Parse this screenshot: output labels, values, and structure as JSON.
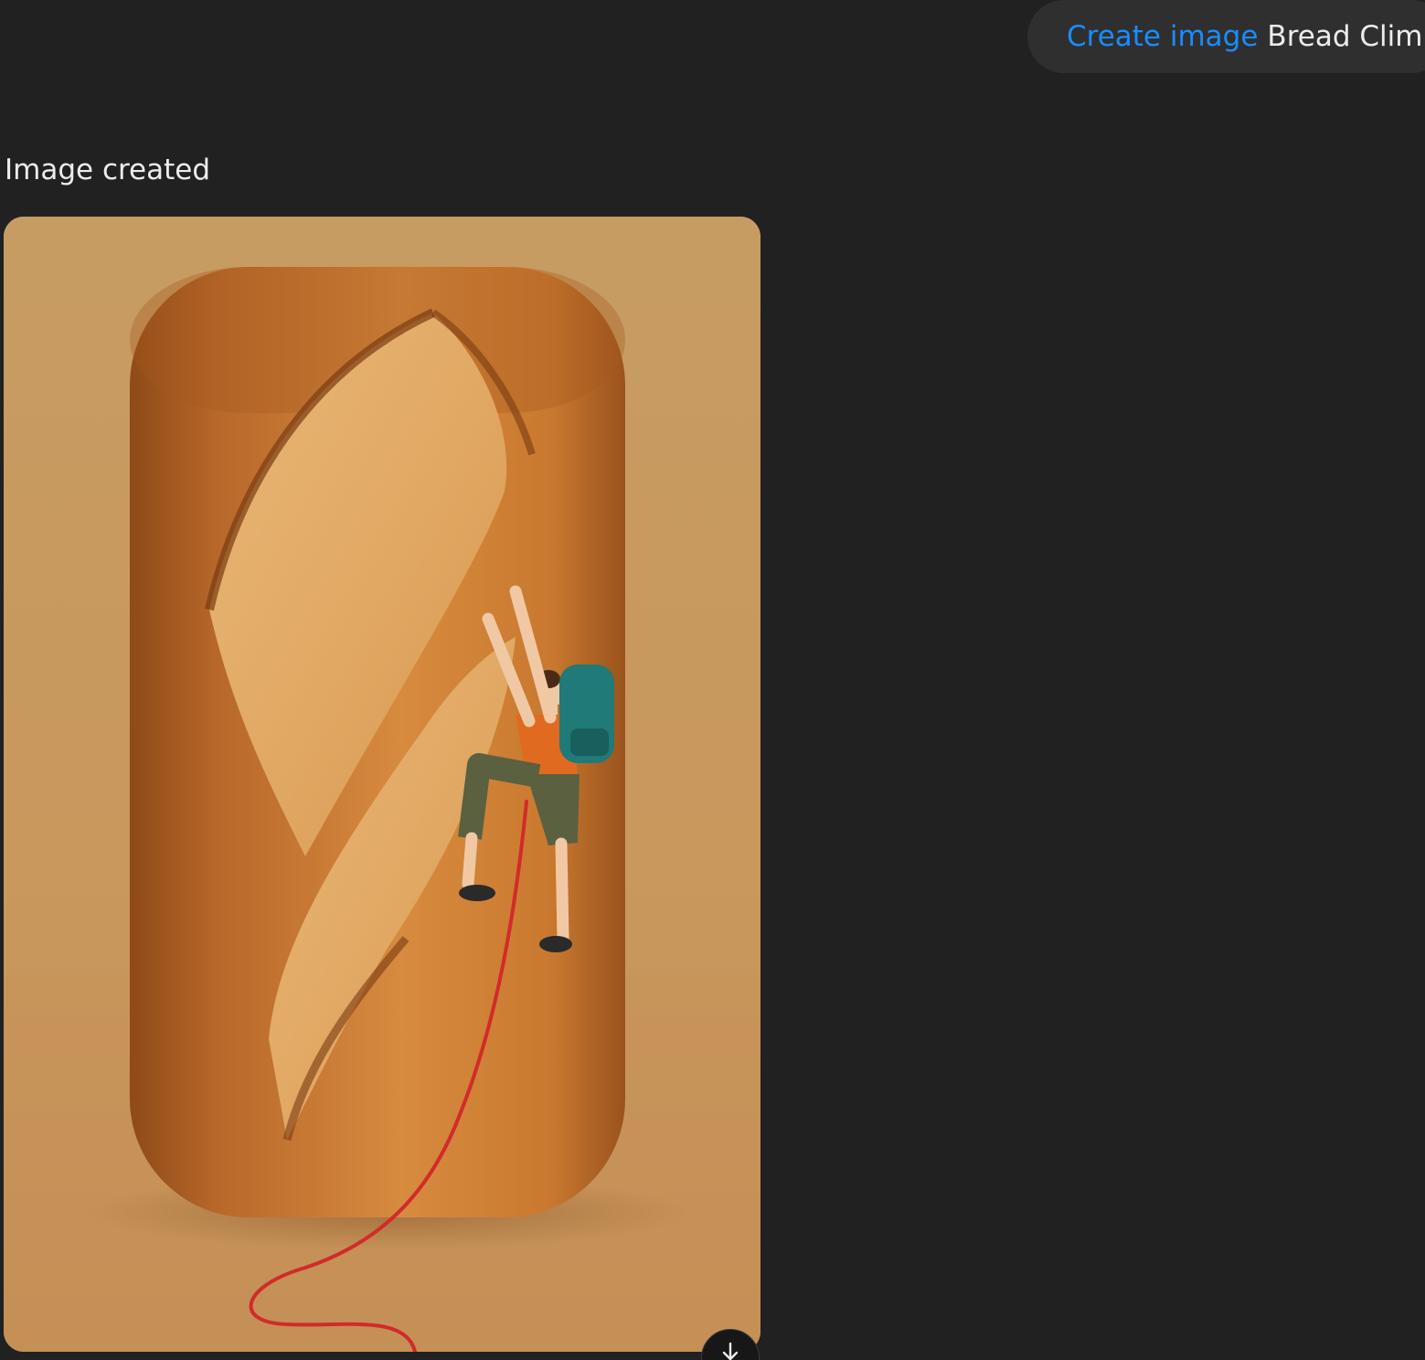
{
  "user_message": {
    "command": "Create image",
    "text": "Bread Climp"
  },
  "assistant": {
    "status": "Image created"
  },
  "generated_image": {
    "icon": "generated-image"
  },
  "actions": {
    "download_icon": "download-icon"
  },
  "colors": {
    "page_background": "#212121",
    "bubble_background": "#2f2f2f",
    "command_accent": "#1a8cff",
    "text": "#ececec"
  }
}
